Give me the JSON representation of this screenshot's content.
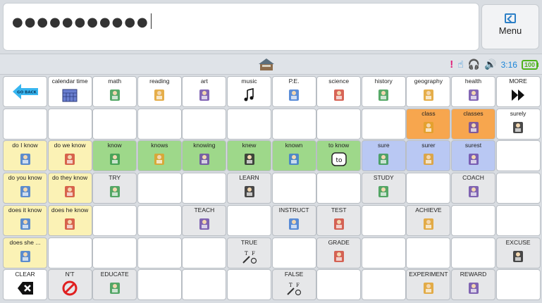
{
  "message": {
    "text": "●●●●●●●●●●●"
  },
  "menu": {
    "label": "Menu"
  },
  "status": {
    "time": "3:16",
    "battery": "100"
  },
  "colors": {
    "yellow": "#fbf2b5",
    "green": "#9ed88a",
    "blue": "#b9c8f3",
    "orange": "#f7a64e",
    "gray": "#e6e7e9",
    "accent": "#1a84d8"
  },
  "grid": {
    "rows": [
      [
        {
          "label": "GO BACK",
          "icon": "arrow-left-icon",
          "color": "white"
        },
        {
          "label": "calendar time",
          "icon": "calendar-icon",
          "color": "white"
        },
        {
          "label": "math",
          "icon": "calculator-icon",
          "color": "white"
        },
        {
          "label": "reading",
          "icon": "books-icon",
          "color": "white"
        },
        {
          "label": "art",
          "icon": "paint-brushes-icon",
          "color": "white"
        },
        {
          "label": "music",
          "icon": "music-note-icon",
          "color": "white"
        },
        {
          "label": "P.E.",
          "icon": "sports-icon",
          "color": "white"
        },
        {
          "label": "science",
          "icon": "beaker-icon",
          "color": "white"
        },
        {
          "label": "history",
          "icon": "history-book-icon",
          "color": "white"
        },
        {
          "label": "geography",
          "icon": "map-book-icon",
          "color": "white"
        },
        {
          "label": "health",
          "icon": "health-icon",
          "color": "white"
        },
        {
          "label": "MORE",
          "icon": "fast-forward-icon",
          "color": "white"
        }
      ],
      [
        {
          "label": "",
          "icon": "",
          "color": "white"
        },
        {
          "label": "",
          "icon": "",
          "color": "white"
        },
        {
          "label": "",
          "icon": "",
          "color": "white"
        },
        {
          "label": "",
          "icon": "",
          "color": "white"
        },
        {
          "label": "",
          "icon": "",
          "color": "white"
        },
        {
          "label": "",
          "icon": "",
          "color": "white"
        },
        {
          "label": "",
          "icon": "",
          "color": "white"
        },
        {
          "label": "",
          "icon": "",
          "color": "white"
        },
        {
          "label": "",
          "icon": "",
          "color": "white"
        },
        {
          "label": "class",
          "icon": "classroom-icon",
          "color": "orange"
        },
        {
          "label": "classes",
          "icon": "classes-icon",
          "color": "orange"
        },
        {
          "label": "surely",
          "icon": "surely-icon",
          "color": "white"
        }
      ],
      [
        {
          "label": "do I know",
          "icon": "person-question-icon",
          "color": "yellow"
        },
        {
          "label": "do we know",
          "icon": "people-question-icon",
          "color": "yellow"
        },
        {
          "label": "know",
          "icon": "know-icon",
          "color": "green"
        },
        {
          "label": "knows",
          "icon": "knows-icon",
          "color": "green"
        },
        {
          "label": "knowing",
          "icon": "knowing-icon",
          "color": "green"
        },
        {
          "label": "knew",
          "icon": "knew-icon",
          "color": "green"
        },
        {
          "label": "known",
          "icon": "known-icon",
          "color": "green"
        },
        {
          "label": "to know",
          "icon": "to-icon",
          "color": "green"
        },
        {
          "label": "sure",
          "icon": "sure-icon",
          "color": "blue"
        },
        {
          "label": "surer",
          "icon": "surer-icon",
          "color": "blue"
        },
        {
          "label": "surest",
          "icon": "surest-icon",
          "color": "blue"
        },
        {
          "label": "",
          "icon": "",
          "color": "white"
        }
      ],
      [
        {
          "label": "do you know",
          "icon": "point-you-icon",
          "color": "yellow"
        },
        {
          "label": "do they know",
          "icon": "they-icon",
          "color": "yellow"
        },
        {
          "label": "TRY",
          "icon": "try-icon",
          "color": "gray"
        },
        {
          "label": "",
          "icon": "",
          "color": "white"
        },
        {
          "label": "",
          "icon": "",
          "color": "white"
        },
        {
          "label": "LEARN",
          "icon": "learn-icon",
          "color": "gray"
        },
        {
          "label": "",
          "icon": "",
          "color": "white"
        },
        {
          "label": "",
          "icon": "",
          "color": "white"
        },
        {
          "label": "STUDY",
          "icon": "study-icon",
          "color": "gray"
        },
        {
          "label": "",
          "icon": "",
          "color": "white"
        },
        {
          "label": "COACH",
          "icon": "coach-icon",
          "color": "gray"
        },
        {
          "label": "",
          "icon": "",
          "color": "white"
        }
      ],
      [
        {
          "label": "does it know",
          "icon": "animal-icon",
          "color": "yellow"
        },
        {
          "label": "does he know",
          "icon": "he-icon",
          "color": "yellow"
        },
        {
          "label": "",
          "icon": "",
          "color": "white"
        },
        {
          "label": "",
          "icon": "",
          "color": "white"
        },
        {
          "label": "TEACH",
          "icon": "teach-icon",
          "color": "gray"
        },
        {
          "label": "",
          "icon": "",
          "color": "white"
        },
        {
          "label": "INSTRUCT",
          "icon": "instruct-icon",
          "color": "gray"
        },
        {
          "label": "TEST",
          "icon": "test-icon",
          "color": "gray"
        },
        {
          "label": "",
          "icon": "",
          "color": "white"
        },
        {
          "label": "ACHIEVE",
          "icon": "achieve-icon",
          "color": "gray"
        },
        {
          "label": "",
          "icon": "",
          "color": "white"
        },
        {
          "label": "",
          "icon": "",
          "color": "white"
        }
      ],
      [
        {
          "label": "does she ...",
          "icon": "she-icon",
          "color": "yellow"
        },
        {
          "label": "",
          "icon": "",
          "color": "white"
        },
        {
          "label": "",
          "icon": "",
          "color": "white"
        },
        {
          "label": "",
          "icon": "",
          "color": "white"
        },
        {
          "label": "",
          "icon": "",
          "color": "white"
        },
        {
          "label": "TRUE",
          "icon": "true-icon",
          "color": "gray"
        },
        {
          "label": "",
          "icon": "",
          "color": "white"
        },
        {
          "label": "GRADE",
          "icon": "grade-icon",
          "color": "gray"
        },
        {
          "label": "",
          "icon": "",
          "color": "white"
        },
        {
          "label": "",
          "icon": "",
          "color": "white"
        },
        {
          "label": "",
          "icon": "",
          "color": "white"
        },
        {
          "label": "EXCUSE",
          "icon": "excuse-icon",
          "color": "gray"
        }
      ],
      [
        {
          "label": "CLEAR",
          "icon": "clear-icon",
          "color": "white"
        },
        {
          "label": "N'T",
          "icon": "no-icon",
          "color": "gray"
        },
        {
          "label": "EDUCATE",
          "icon": "educate-icon",
          "color": "gray"
        },
        {
          "label": "",
          "icon": "",
          "color": "white"
        },
        {
          "label": "",
          "icon": "",
          "color": "white"
        },
        {
          "label": "",
          "icon": "",
          "color": "white"
        },
        {
          "label": "FALSE",
          "icon": "false-icon",
          "color": "gray"
        },
        {
          "label": "",
          "icon": "",
          "color": "white"
        },
        {
          "label": "",
          "icon": "",
          "color": "white"
        },
        {
          "label": "EXPERIMENT",
          "icon": "experiment-icon",
          "color": "gray"
        },
        {
          "label": "REWARD",
          "icon": "reward-icon",
          "color": "gray"
        },
        {
          "label": "",
          "icon": "",
          "color": "white"
        }
      ]
    ]
  }
}
